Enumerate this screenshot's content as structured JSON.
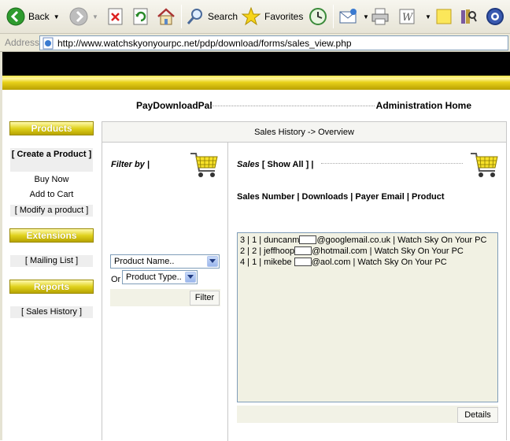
{
  "toolbar": {
    "back_label": "Back",
    "search_label": "Search",
    "favorites_label": "Favorites"
  },
  "address_bar": {
    "label": "Address",
    "url": "http://www.watchskyonyourpc.net/pdp/download/forms/sales_view.php"
  },
  "header": {
    "brand": "PayDownloadPal",
    "admin_home": "Administration Home"
  },
  "sidebar": {
    "products_title": "Products",
    "create_product": "[ Create a Product ]",
    "buy_now": "Buy Now",
    "add_to_cart": "Add to Cart",
    "modify_product": "[ Modify a product ]",
    "extensions_title": "Extensions",
    "mailing_list": "[ Mailing List ]",
    "reports_title": "Reports",
    "sales_history": "[ Sales History ]"
  },
  "main": {
    "title_prefix": "Sales History -> ",
    "title_current": "Overview",
    "filter_by": "Filter by |",
    "product_name_select": "Product Name..",
    "or_label": "Or",
    "product_type_select": "Product Type..",
    "filter_button": "Filter",
    "sales_label": "Sales",
    "show_all": "[ Show All ] |",
    "columns_header": "Sales Number | Downloads | Payer Email | Product",
    "sales": [
      {
        "prefix": "3 | 1 | duncanm",
        "domain": "@googlemail.co.uk",
        "product": " | Watch Sky On Your PC"
      },
      {
        "prefix": "2 | 2 | jeffhoop",
        "domain": "@hotmail.com",
        "product": " | Watch Sky On Your PC"
      },
      {
        "prefix": "4 | 1 | mikebe ",
        "domain": "@aol.com",
        "product": " | Watch Sky On Your PC"
      }
    ],
    "details_button": "Details"
  }
}
